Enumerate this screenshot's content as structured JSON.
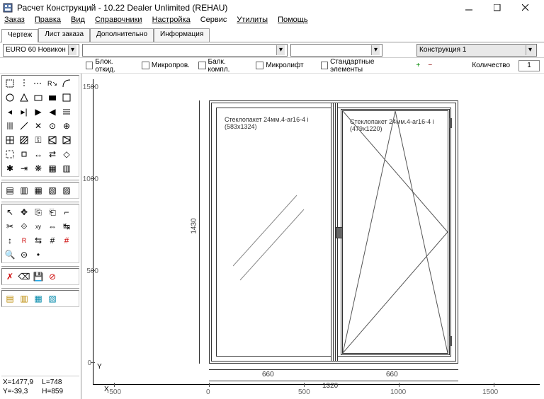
{
  "window": {
    "title": "Расчет Конструкций - 10.22 Dealer Unlimited (REHAU)"
  },
  "menu": {
    "zakaz": "Заказ",
    "pravka": "Правка",
    "vid": "Вид",
    "spravochniki": "Справочники",
    "nastroyka": "Настройка",
    "servis": "Сервис",
    "utility": "Утилиты",
    "pomosch": "Помощь"
  },
  "tabs": {
    "t1": "Чертеж",
    "t2": "Лист заказа",
    "t3": "Дополнительно",
    "t4": "Информация"
  },
  "filters": {
    "profile": "EURO 60 Новикон",
    "empty1": "",
    "empty2": "",
    "construct": "Конструкция 1"
  },
  "options": {
    "blok": "Блок. откид.",
    "micro": "Микропров.",
    "balk": "Балк. компл.",
    "microlift": "Микролифт",
    "std": "Стандартные элементы",
    "qty_label": "Количество",
    "qty": "1"
  },
  "ruler": {
    "y1500": "1500",
    "y1000": "1000",
    "y500": "500",
    "y0": "0",
    "xn500": "-500",
    "x0": "0",
    "x500": "500",
    "x1000": "1000",
    "x1500": "1500"
  },
  "pane1": {
    "title": "Стеклопакет 24мм.4-ar16-4 i",
    "dim": "(583x1324)"
  },
  "pane2": {
    "title": "Стеклопакет 24мм.4-ar16-4 i",
    "dim": "(479x1220)"
  },
  "dims": {
    "height": "1430",
    "w1": "660",
    "w2": "660",
    "total": "1320"
  },
  "sym": {
    "plus": "+",
    "minus": "−"
  },
  "status": {
    "x_lbl": "X=",
    "x": "1477,9",
    "l_lbl": "L=",
    "l": "748",
    "y_lbl": "Y=",
    "y": "-39,3",
    "h_lbl": "H=",
    "h": "859"
  },
  "axis": {
    "y": "Y",
    "x": "X"
  }
}
